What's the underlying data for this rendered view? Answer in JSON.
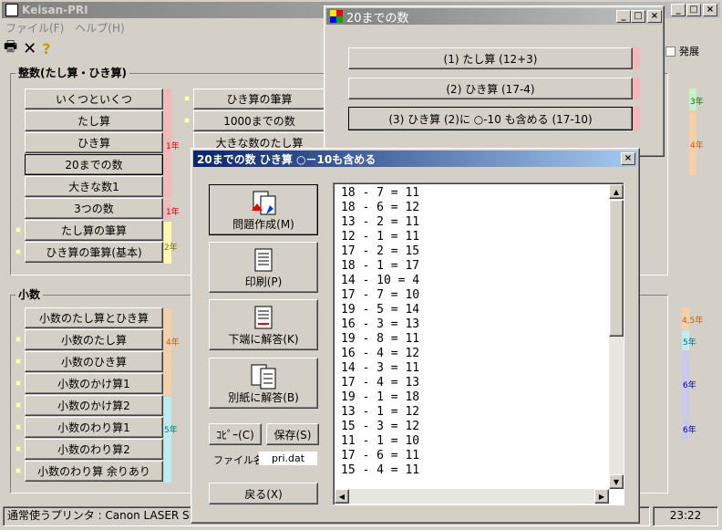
{
  "main_window": {
    "title": "Keisan-PRI",
    "menu": [
      "ファイル(F)",
      "ヘルプ(H)"
    ],
    "seitsu_label": "整数(たし算・ひき算)",
    "shousu_label": "小数",
    "col1_buttons": [
      "いくつといくつ",
      "たし算",
      "ひき算",
      "20までの数",
      "大きな数1",
      "3つの数",
      "たし算の筆算",
      "ひき算の筆算(基本)"
    ],
    "col2_buttons": [
      "ひき算の筆算",
      "1000までの数",
      "大きな数のたし算"
    ],
    "shousu_buttons": [
      "小数のたし算とひき算",
      "小数のたし算",
      "小数のひき算",
      "小数のかけ算1",
      "小数のかけ算2",
      "小数のわり算1",
      "小数のわり算2",
      "小数のわり算 余りあり"
    ],
    "grades": {
      "g1a": "1年",
      "g1b": "1年",
      "g2": "2年",
      "g3": "3年",
      "g4": "4年",
      "g4b": "4年",
      "g5": "5年",
      "g45": "4,5年",
      "g5b": "5年",
      "g6a": "6年",
      "g6b": "6年"
    },
    "hatten_label": "発展",
    "status_printer": "通常使うプリンタ : Canon LASER SHOT",
    "status_time": "23:22",
    "colors": {
      "pink": "#f4b8b8",
      "peach": "#f8d0a8",
      "yellow": "#fff8b0",
      "cyan": "#bcecf4",
      "green": "#c8f0c8",
      "lavender": "#c8c8f0"
    }
  },
  "sub_window": {
    "title": "20までの数",
    "options": [
      "(1) たし算 (12+3)",
      "(2) ひき算 (17-4)",
      "(3) ひき算 (2)に ○-10 も含める (17-10)"
    ]
  },
  "dialog": {
    "title": "20までの数 ひき算 ○－10も含める",
    "buttons": {
      "make": "問題作成(M)",
      "print": "印刷(P)",
      "answer_bottom": "下端に解答(K)",
      "answer_sep": "別紙に解答(B)",
      "copy": "ｺﾋﾟｰ(C)",
      "save": "保存(S)",
      "back": "戻る(X)"
    },
    "filename_label": "ファイル名:",
    "filename": "pri.dat",
    "problems": [
      "18 - 7 = 11",
      "18 - 6 = 12",
      "13 - 2 = 11",
      "12 - 1 = 11",
      "17 - 2 = 15",
      "18 - 1 = 17",
      "14 - 10 = 4",
      "17 - 7 = 10",
      "19 - 5 = 14",
      "16 - 3 = 13",
      "19 - 8 = 11",
      "16 - 4 = 12",
      "14 - 3 = 11",
      "17 - 4 = 13",
      "19 - 1 = 18",
      "13 - 1 = 12",
      "15 - 3 = 12",
      "11 - 1 = 10",
      "17 - 6 = 11",
      "15 - 4 = 11"
    ]
  }
}
